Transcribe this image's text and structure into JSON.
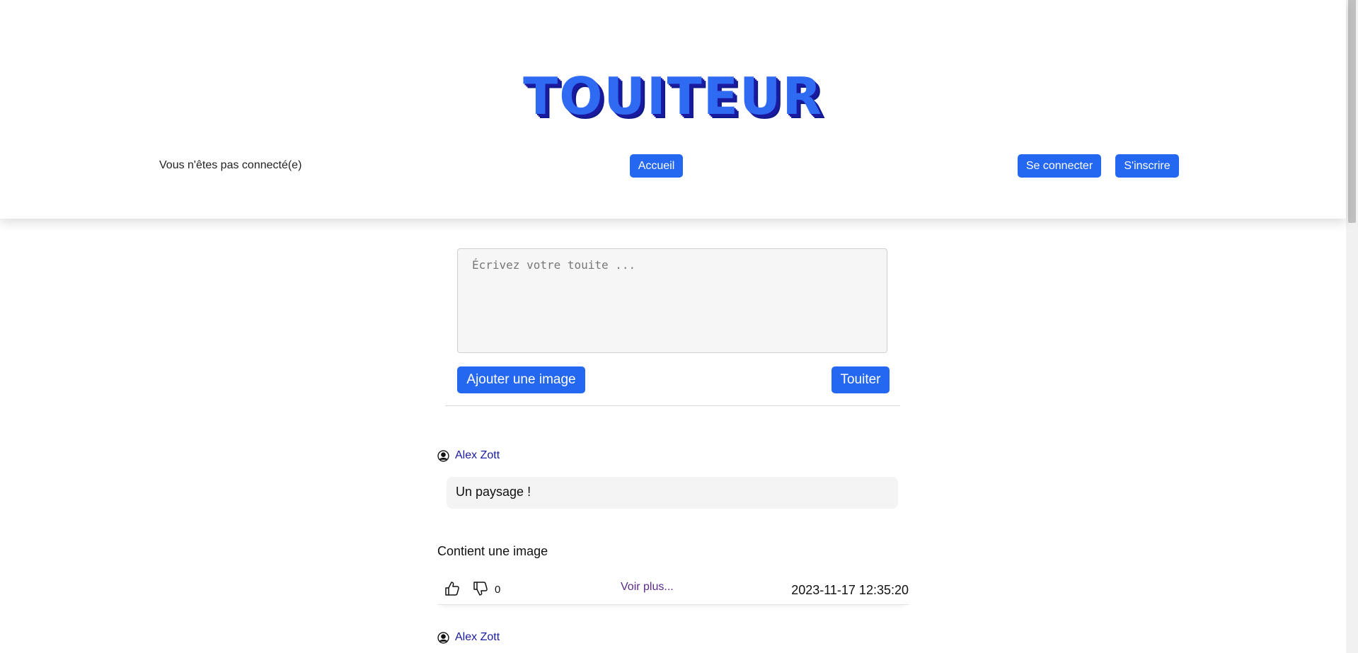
{
  "header": {
    "logo": "TOUITEUR",
    "status": "Vous n'êtes pas connecté(e)",
    "nav": {
      "home": "Accueil",
      "login": "Se connecter",
      "signup": "S'inscrire"
    }
  },
  "composer": {
    "placeholder": "Écrivez votre touite ...",
    "add_image": "Ajouter une image",
    "submit": "Touiter"
  },
  "feed": [
    {
      "author": "Alex Zott",
      "text": "Un paysage !",
      "image_note": "Contient une image",
      "score": "0",
      "more": "Voir plus...",
      "date": "2023-11-17 12:35:20"
    },
    {
      "author": "Alex Zott"
    }
  ],
  "icons": [
    "user-circle-icon",
    "thumbs-up-icon",
    "thumbs-down-icon"
  ],
  "colors": {
    "accent": "#2467f0",
    "logo": "#2f6bf2",
    "author": "#1a1aa0"
  }
}
